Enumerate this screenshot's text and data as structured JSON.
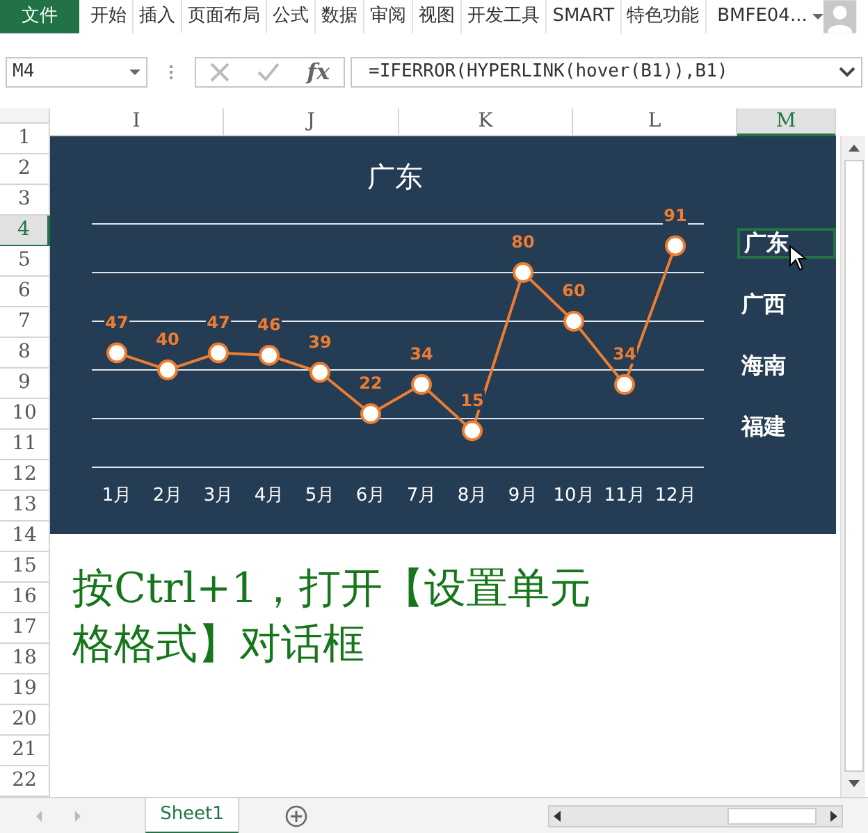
{
  "ribbon_tabs": [
    {
      "label": "文件",
      "kind": "file"
    },
    {
      "label": "开始",
      "kind": "tab"
    },
    {
      "label": "插入",
      "kind": "tab"
    },
    {
      "label": "页面布局",
      "kind": "tab"
    },
    {
      "label": "公式",
      "kind": "tab"
    },
    {
      "label": "数据",
      "kind": "tab"
    },
    {
      "label": "审阅",
      "kind": "tab"
    },
    {
      "label": "视图",
      "kind": "tab"
    },
    {
      "label": "开发工具",
      "kind": "tab"
    },
    {
      "label": "SMART",
      "kind": "tab"
    },
    {
      "label": "特色功能",
      "kind": "tab"
    }
  ],
  "account": "BMFE04...",
  "name_box": "M4",
  "fx_label": "fx",
  "formula": "=IFERROR(HYPERLINK(hover(B1)),B1)",
  "columns": [
    {
      "label": "I",
      "selected": false
    },
    {
      "label": "J",
      "selected": false
    },
    {
      "label": "K",
      "selected": false
    },
    {
      "label": "L",
      "selected": false
    },
    {
      "label": "M",
      "selected": true
    }
  ],
  "rows": [
    {
      "label": "1",
      "selected": false
    },
    {
      "label": "2",
      "selected": false
    },
    {
      "label": "3",
      "selected": false
    },
    {
      "label": "4",
      "selected": true
    },
    {
      "label": "5",
      "selected": false
    },
    {
      "label": "6",
      "selected": false
    },
    {
      "label": "7",
      "selected": false
    },
    {
      "label": "8",
      "selected": false
    },
    {
      "label": "9",
      "selected": false
    },
    {
      "label": "10",
      "selected": false
    },
    {
      "label": "11",
      "selected": false
    },
    {
      "label": "12",
      "selected": false
    },
    {
      "label": "13",
      "selected": false
    },
    {
      "label": "14",
      "selected": false
    },
    {
      "label": "15",
      "selected": false
    },
    {
      "label": "16",
      "selected": false
    },
    {
      "label": "17",
      "selected": false
    },
    {
      "label": "18",
      "selected": false
    },
    {
      "label": "19",
      "selected": false
    },
    {
      "label": "20",
      "selected": false
    },
    {
      "label": "21",
      "selected": false
    },
    {
      "label": "22",
      "selected": false
    }
  ],
  "chart": {
    "chart_data": {
      "type": "line",
      "categories": [
        "1月",
        "2月",
        "3月",
        "4月",
        "5月",
        "6月",
        "7月",
        "8月",
        "9月",
        "10月",
        "11月",
        "12月"
      ],
      "series": [
        {
          "name": "广东",
          "color": "#ed7d31",
          "marker": "circle",
          "values": [
            47,
            40,
            47,
            46,
            39,
            22,
            34,
            15,
            80,
            60,
            34,
            91
          ]
        }
      ],
      "ylim": [
        0,
        100
      ],
      "data_labels": true
    }
  },
  "region_cells": [
    {
      "text": "广东",
      "selected": true
    },
    {
      "text": "广西",
      "selected": false
    },
    {
      "text": "海南",
      "selected": false
    },
    {
      "text": "福建",
      "selected": false
    }
  ],
  "note_lines": [
    "按Ctrl+1，打开【设置单元",
    "格格式】对话框"
  ],
  "sheet_tabs": [
    {
      "label": "Sheet1",
      "selected": true
    }
  ]
}
